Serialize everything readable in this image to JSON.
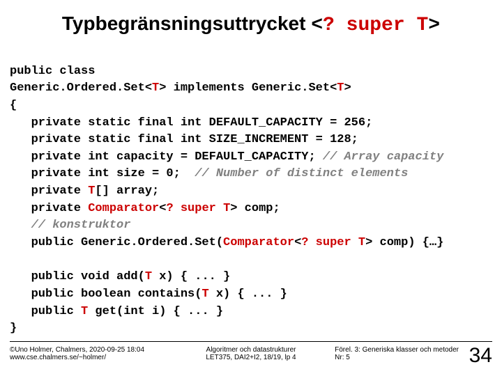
{
  "title": {
    "plain": "Typbegränsningsuttrycket ",
    "mono_pre": "<",
    "mono_red": "? super T",
    "mono_post": ">"
  },
  "code": {
    "l1": "public class",
    "l2a": "Generic.Ordered.Set<",
    "l2b": "T",
    "l2c": "> implements Generic.Set<",
    "l2d": "T",
    "l2e": ">",
    "l3": "{",
    "l4": "private static final int DEFAULT_CAPACITY = 256;",
    "l5": "private static final int SIZE_INCREMENT = 128;",
    "l6a": "private int capacity = DEFAULT_CAPACITY; ",
    "l6b": "// Array capacity",
    "l7a": "private int size = 0;  ",
    "l7b": "// Number of distinct elements",
    "l8a": "private ",
    "l8b": "T",
    "l8c": "[] array;",
    "l9a": "private ",
    "l9b": "Comparator",
    "l9c": "<",
    "l9d": "? super T",
    "l9e": "> comp;",
    "l10": "// konstruktor",
    "l11a": "public Generic.Ordered.Set(",
    "l11b": "Comparator",
    "l11c": "<",
    "l11d": "? super T",
    "l11e": "> comp) {…}",
    "l12a": "public void add(",
    "l12b": "T",
    "l12c": " x) { ... }",
    "l13a": "public boolean contains(",
    "l13b": "T",
    "l13c": " x) { ... }",
    "l14a": "public ",
    "l14b": "T",
    "l14c": " get(int i) { ... }",
    "l15": "}"
  },
  "footer": {
    "left1": "©Uno Holmer, Chalmers, 2020-09-25 18:04",
    "left2": "www.cse.chalmers.se/~holmer/",
    "mid1": "Algoritmer och datastrukturer",
    "mid2": "LET375, DAI2+I2, 18/19, lp 4",
    "right1": "Förel. 3: Generiska klasser och metoder",
    "right2": "Nr: 5",
    "page": "34"
  }
}
